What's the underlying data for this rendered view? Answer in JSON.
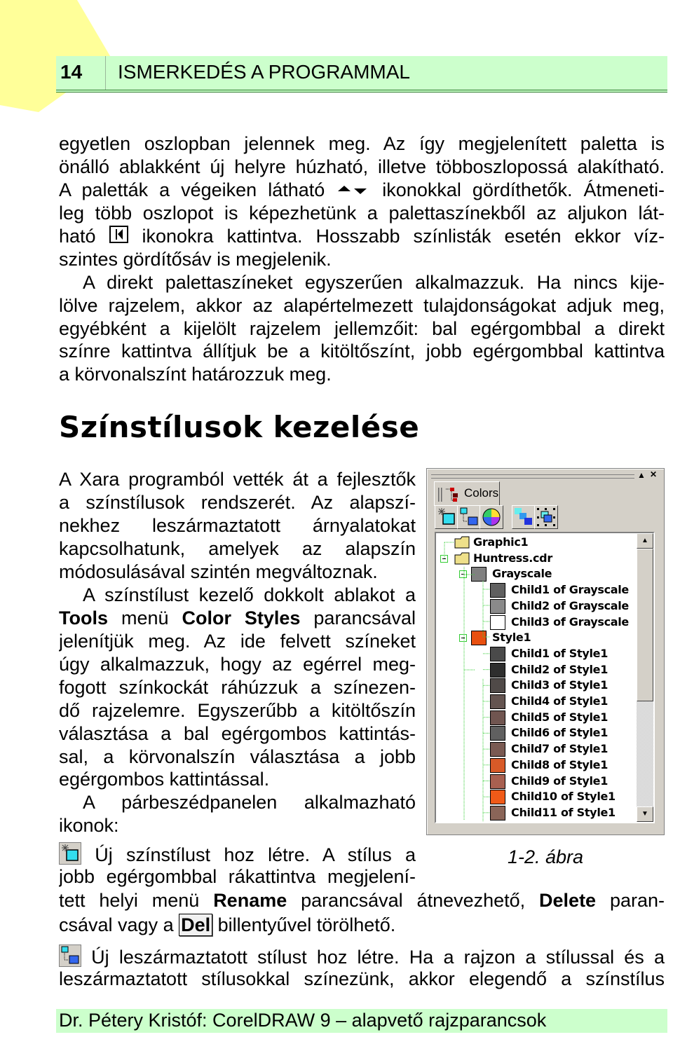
{
  "header": {
    "page_number": "14",
    "chapter_title": "ISMERKEDÉS A PROGRAMMAL",
    "accent": "#ccffcc",
    "rule": "#2a7a2a"
  },
  "heading": "Színstílusok kezelése",
  "lines": [
    [
      {
        "t": "egyetlen oszlopban jelennek meg. Az így megjelenített paletta is"
      }
    ],
    [
      {
        "t": "önálló ablakként új helyre húzható, illetve többoszlopossá alakítható."
      }
    ],
    [
      {
        "t": "A paletták a végeiken látható "
      },
      {
        "icon": "scroll-arrows-icon"
      },
      {
        "t": " ikonokkal gördíthetők. Átmeneti-"
      }
    ],
    [
      {
        "t": "leg több oszlopot is képezhetünk a palettaszínekből az aljukon lát-"
      }
    ],
    [
      {
        "t": "ható "
      },
      {
        "icon": "column-button-icon"
      },
      {
        "t": " ikonokra kattintva. Hosszabb színlisták esetén ekkor víz-"
      }
    ],
    [
      {
        "t": "szintes gördítősáv is megjelenik."
      }
    ],
    [
      {
        "t": "A direkt palettaszíneket egyszerűen alkalmazzuk. Ha nincs kije-"
      }
    ],
    [
      {
        "t": "lölve rajzelem, akkor az alapértelmezett tulajdonságokat adjuk meg,"
      }
    ],
    [
      {
        "t": "egyébként a kijelölt rajzelem jellemzőit: bal egérgombbal a direkt"
      }
    ],
    [
      {
        "t": "színre kattintva állítjuk be a kitöltőszínt, jobb egérgombbal kattintva"
      }
    ],
    [
      {
        "t": "a körvonalszínt határozzuk meg."
      }
    ],
    [
      {
        "t": "A Xara programból vették át a fejlesztők"
      }
    ],
    [
      {
        "t": "a színstílusok rendszerét. Az alapszí-"
      }
    ],
    [
      {
        "t": "nekhez leszármaztatott árnyalatokat"
      }
    ],
    [
      {
        "t": "kapcsolhatunk, amelyek az alapszín"
      }
    ],
    [
      {
        "t": "módosulásával szintén megváltoznak."
      }
    ],
    [
      {
        "t": "A színstílust kezelő dokkolt ablakot a"
      }
    ],
    [
      {
        "b": "Tools"
      },
      {
        "t": " menü "
      },
      {
        "b": "Color Styles"
      },
      {
        "t": " parancsával"
      }
    ],
    [
      {
        "t": "jelenítjük meg. Az ide felvett színeket"
      }
    ],
    [
      {
        "t": "úgy alkalmazzuk, hogy az egérrel meg-"
      }
    ],
    [
      {
        "t": "fogott színkockát ráhúzzuk a színezen-"
      }
    ],
    [
      {
        "t": "dő rajzelemre. Egyszerűbb a kitöltőszín"
      }
    ],
    [
      {
        "t": "választása a bal egérgombos kattintás-"
      }
    ],
    [
      {
        "t": "sal, a körvonalszín választása a jobb"
      }
    ],
    [
      {
        "t": "egérgombos kattintással."
      }
    ],
    [
      {
        "t": "A párbeszédpanelen alkalmazható"
      }
    ],
    [
      {
        "t": "ikonok:"
      }
    ],
    [
      {
        "icon": "new-style-icon"
      },
      {
        "t": " Új színstílust hoz létre. A stílus a"
      }
    ],
    [
      {
        "t": "jobb egérgombbal rákattintva megjelení-"
      }
    ],
    [
      {
        "t": "tett helyi menü "
      },
      {
        "b": "Rename"
      },
      {
        "t": " parancsával átnevezhető, "
      },
      {
        "b": "Delete"
      },
      {
        "t": " paran-"
      }
    ],
    [
      {
        "t": "csával vagy a "
      },
      {
        "key": "Del"
      },
      {
        "t": " billentyűvel törölhető."
      }
    ],
    [
      {
        "icon": "new-child-style-icon"
      },
      {
        "t": " Új leszármaztatott stílust hoz létre. Ha a rajzon a stílussal és a"
      }
    ],
    [
      {
        "t": "leszármaztatott stílusokkal színezünk, akkor elegendő a színstílus"
      }
    ]
  ],
  "figure": {
    "caption": "1-2. ábra",
    "panel": {
      "title_buttons": [
        "▲",
        "✕"
      ],
      "tab_label": "Colors",
      "toolbar_icons": [
        "new-style-icon",
        "new-child-style-icon",
        "color-wheel-icon",
        "gradient-icon",
        "select-icon"
      ],
      "tree": [
        {
          "name": "Graphic1",
          "kind": "folder",
          "level": 0
        },
        {
          "name": "Huntress.cdr",
          "kind": "folder",
          "level": 0,
          "expanded": true
        },
        {
          "name": "Grayscale",
          "level": 1,
          "color": "#808080",
          "expanded": true
        },
        {
          "name": "Child1 of Grayscale",
          "level": 2,
          "color": "#606060"
        },
        {
          "name": "Child2 of Grayscale",
          "level": 2,
          "color": "#8a8a8a"
        },
        {
          "name": "Child3 of Grayscale",
          "level": 2,
          "color": "#ffffff"
        },
        {
          "name": "Style1",
          "level": 1,
          "color": "#e85010",
          "expanded": true
        },
        {
          "name": "Child1 of Style1",
          "level": 2,
          "color": "#4a4a4a"
        },
        {
          "name": "Child2 of Style1",
          "level": 2,
          "color": "#2e2e2e"
        },
        {
          "name": "Child3 of Style1",
          "level": 2,
          "color": "#504a48"
        },
        {
          "name": "Child4 of Style1",
          "level": 2,
          "color": "#645450"
        },
        {
          "name": "Child5 of Style1",
          "level": 2,
          "color": "#705550"
        },
        {
          "name": "Child6 of Style1",
          "level": 2,
          "color": "#606060"
        },
        {
          "name": "Child7 of Style1",
          "level": 2,
          "color": "#7a5a52"
        },
        {
          "name": "Child8 of Style1",
          "level": 2,
          "color": "#d85a28"
        },
        {
          "name": "Child9 of Style1",
          "level": 2,
          "color": "#a86050"
        },
        {
          "name": "Child10 of Style1",
          "level": 2,
          "color": "#f05a18"
        },
        {
          "name": "Child11 of Style1",
          "level": 2,
          "color": "#8a6558"
        }
      ]
    }
  },
  "footer": "Dr. Pétery Kristóf: CorelDRAW 9 – alapvető rajzparancsok"
}
